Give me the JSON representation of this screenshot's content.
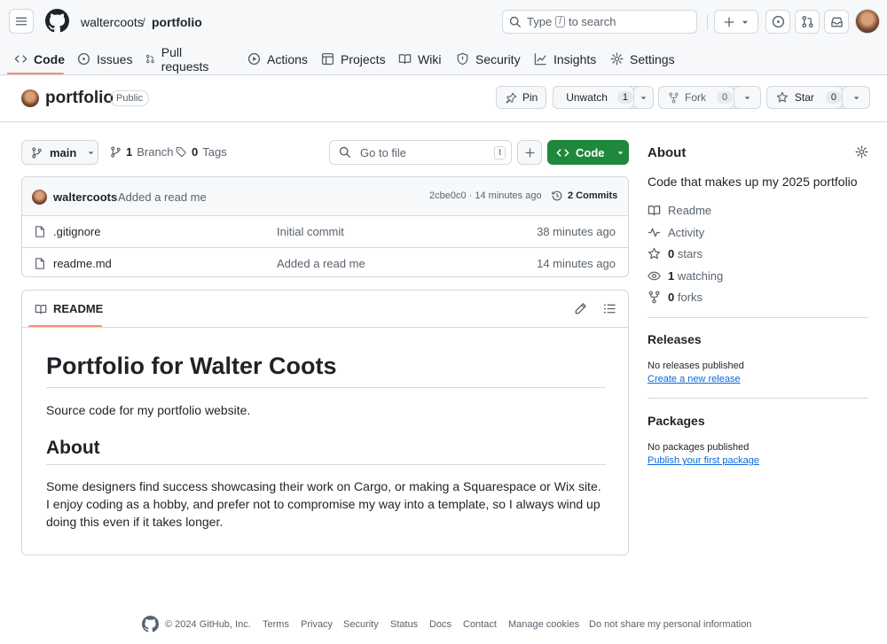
{
  "header": {
    "owner": "waltercoots",
    "separator": "/",
    "repo": "portfolio",
    "search_type": "Type",
    "search_kbd": "/",
    "search_rest": "to search"
  },
  "tabs": [
    {
      "label": "Code",
      "icon": "code-icon"
    },
    {
      "label": "Issues",
      "icon": "issue-icon"
    },
    {
      "label": "Pull requests",
      "icon": "pull-request-icon"
    },
    {
      "label": "Actions",
      "icon": "play-icon"
    },
    {
      "label": "Projects",
      "icon": "table-icon"
    },
    {
      "label": "Wiki",
      "icon": "book-icon"
    },
    {
      "label": "Security",
      "icon": "shield-icon"
    },
    {
      "label": "Insights",
      "icon": "graph-icon"
    },
    {
      "label": "Settings",
      "icon": "gear-icon"
    }
  ],
  "repo_header": {
    "name": "portfolio",
    "visibility": "Public",
    "pin": "Pin",
    "unwatch": "Unwatch",
    "watch_count": "1",
    "fork": "Fork",
    "fork_count": "0",
    "star": "Star",
    "star_count": "0"
  },
  "toolbar": {
    "branch": "main",
    "branch_count": "1",
    "branch_label": "Branch",
    "tag_count": "0",
    "tag_label": "Tags",
    "goto_placeholder": "Go to file",
    "goto_kbd": "t",
    "code_label": "Code"
  },
  "commit": {
    "author": "waltercoots",
    "message": "Added a read me",
    "meta": "2cbe0c0 · 14 minutes ago",
    "commits_label": "2 Commits"
  },
  "files": [
    {
      "name": ".gitignore",
      "message": "Initial commit",
      "time": "38 minutes ago"
    },
    {
      "name": "readme.md",
      "message": "Added a read me",
      "time": "14 minutes ago"
    }
  ],
  "readme": {
    "tab": "README",
    "h1": "Portfolio for Walter Coots",
    "p1": "Source code for my portfolio website.",
    "h2": "About",
    "p2": "Some designers find success showcasing their work on Cargo, or making a Squarespace or Wix site. I enjoy coding as a hobby, and prefer not to compromise my way into a template, so I always wind up doing this even if it takes longer."
  },
  "sidebar": {
    "about_title": "About",
    "description": "Code that makes up my 2025 portfolio",
    "readme": "Readme",
    "activity": "Activity",
    "stars_count": "0",
    "stars_label": "stars",
    "watching_count": "1",
    "watching_label": "watching",
    "forks_count": "0",
    "forks_label": "forks",
    "releases_title": "Releases",
    "no_releases": "No releases published",
    "create_release": "Create a new release",
    "packages_title": "Packages",
    "no_packages": "No packages published",
    "publish_package": "Publish your first package"
  },
  "footer": {
    "copyright": "© 2024 GitHub, Inc.",
    "links": [
      "Terms",
      "Privacy",
      "Security",
      "Status",
      "Docs",
      "Contact",
      "Manage cookies",
      "Do not share my personal information"
    ]
  }
}
